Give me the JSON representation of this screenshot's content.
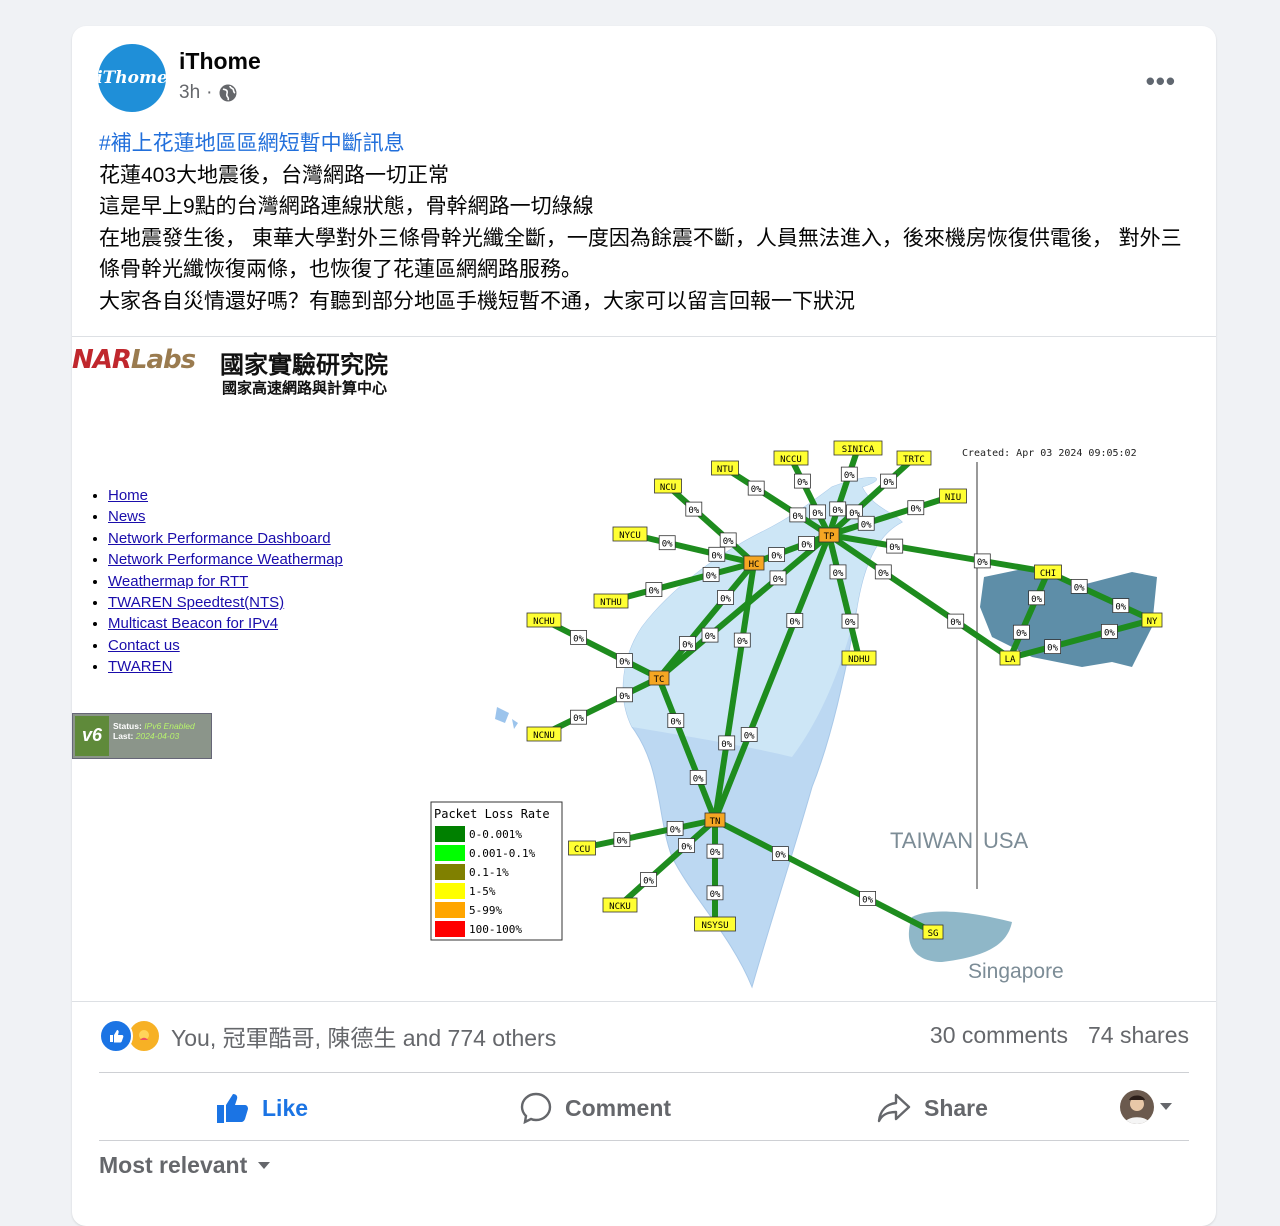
{
  "post": {
    "page_name": "iThome",
    "avatar_text": "iThome",
    "time": "3h",
    "more_label": "•••",
    "hashtag": "#補上花蓮地區區網短暫中斷訊息",
    "lines": [
      "花蓮403大地震後，台灣網路一切正常",
      "這是早上9點的台灣網路連線狀態，骨幹網路一切綠線",
      "在地震發生後， 東華大學對外三條骨幹光纖全斷，一度因為餘震不斷，人員無法進入，後來機房恢復供電後， 對外三條骨幹光纖恢復兩條，也恢復了花蓮區網網路服務。",
      "大家各自災情還好嗎？有聽到部分地區手機短暫不通，大家可以留言回報一下狀況"
    ]
  },
  "media": {
    "logo_en_red": "NAR",
    "logo_en_gold": "Labs",
    "logo_zh": "國家實驗研究院",
    "logo_sub": "國家高速網路與計算中心",
    "nav": [
      "Home",
      "News",
      "Network Performance Dashboard",
      "Network Performance Weathermap",
      "Weathermap for RTT",
      "TWAREN Speedtest(NTS)",
      "Multicast Beacon for IPv4",
      "Contact us",
      "TWAREN"
    ],
    "ipv6_badge": "v6",
    "ipv6_status_label": "Status:",
    "ipv6_status": "IPv6 Enabled",
    "ipv6_last_label": "Last:",
    "ipv6_last": "2024-04-03",
    "created": "Created: Apr 03 2024 09:05:02",
    "region_taiwan": "TAIWAN",
    "region_usa": "USA",
    "region_singapore": "Singapore",
    "link_value": "0%",
    "legend_title": "Packet Loss Rate",
    "legend": [
      {
        "label": "0-0.001%",
        "color": "#008000"
      },
      {
        "label": "0.001-0.1%",
        "color": "#00ff00"
      },
      {
        "label": "0.1-1%",
        "color": "#808000"
      },
      {
        "label": "1-5%",
        "color": "#ffff00"
      },
      {
        "label": "5-99%",
        "color": "#ffa500"
      },
      {
        "label": "100-100%",
        "color": "#ff0000"
      }
    ],
    "nodes": [
      "NTU",
      "NCCU",
      "SINICA",
      "TRTC",
      "NIU",
      "NCU",
      "NYCU",
      "NTHU",
      "HC",
      "TP",
      "NCHU",
      "TC",
      "NCNU",
      "NDHU",
      "CHI",
      "NY",
      "LA",
      "TN",
      "CCU",
      "NCKU",
      "NSYSU",
      "SG"
    ]
  },
  "footer": {
    "reactions_text": "You, 冠軍酷哥, 陳德生 and 774 others",
    "comments": "30 comments",
    "shares": "74 shares",
    "like": "Like",
    "comment": "Comment",
    "share": "Share",
    "sort": "Most relevant"
  },
  "colors": {
    "link_blue": "#216fdb",
    "like_blue": "#1b74e4",
    "line_green": "#1e8c1e",
    "hub_orange": "#f5a623",
    "node_yellow": "#ffff33"
  }
}
